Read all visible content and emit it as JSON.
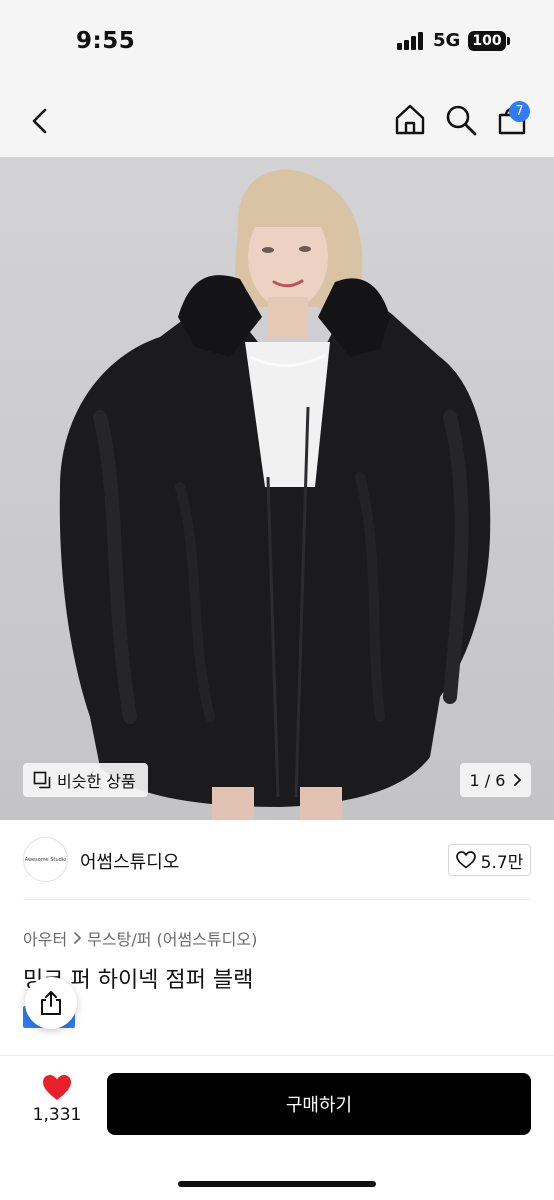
{
  "status_bar": {
    "time": "9:55",
    "network": "5G",
    "battery": "100"
  },
  "nav": {
    "cart_count": "7"
  },
  "gallery": {
    "similar_label": "비슷한 상품",
    "page_indicator": "1 / 6"
  },
  "brand": {
    "logo_text": "Awesome Studio",
    "name": "어썸스튜디오",
    "likes": "5.7만"
  },
  "product": {
    "breadcrumb": [
      "아우터",
      "무스탕/퍼 (어썸스튜디오)"
    ],
    "title": "밍크 퍼 하이넥 점퍼 블랙"
  },
  "bottom": {
    "wish_count": "1,331",
    "buy_label": "구매하기"
  },
  "colors": {
    "accent": "#2f7cf6",
    "heart": "#e8202a",
    "buy_button": "#000000"
  },
  "icons": [
    "back-icon",
    "home-icon",
    "search-icon",
    "cart-icon",
    "similar-icon",
    "chevron-right-icon",
    "heart-outline-icon",
    "share-icon",
    "heart-filled-icon"
  ]
}
